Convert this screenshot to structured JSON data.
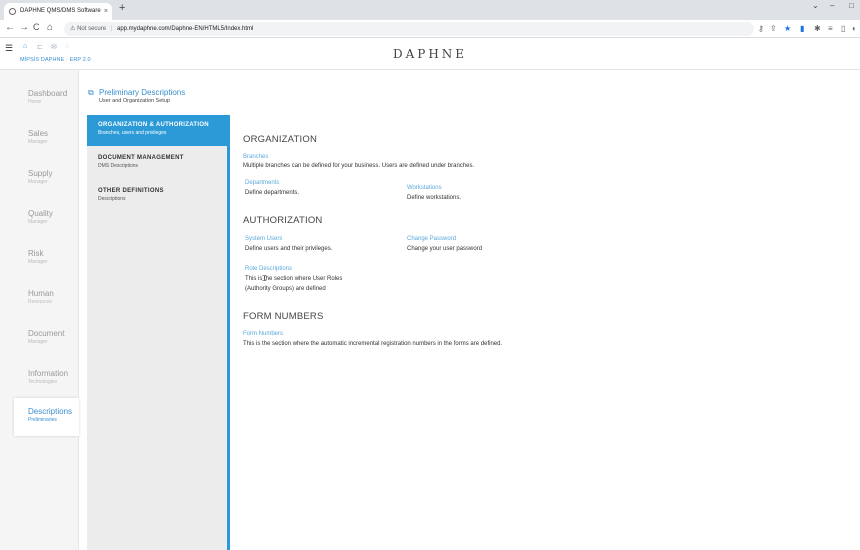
{
  "browser": {
    "tab_title": "DAPHNE QMS/DMS Software",
    "tab_close": "×",
    "new_tab": "+",
    "security": "Not secure",
    "url": "app.mydaphne.com/Daphne-EN/HTML5/Index.html",
    "back": "←",
    "forward": "→",
    "reload": "C",
    "home": "⌂"
  },
  "header": {
    "brand": "DAPHNE",
    "erp_label": "MİPSİS DAPHNE · ERP 2.0"
  },
  "sidebar": {
    "items": [
      {
        "title": "Dashboard",
        "sub": "Home"
      },
      {
        "title": "Sales",
        "sub": "Manager"
      },
      {
        "title": "Supply",
        "sub": "Manager"
      },
      {
        "title": "Quality",
        "sub": "Manager"
      },
      {
        "title": "Risk",
        "sub": "Manager"
      },
      {
        "title": "Human",
        "sub": "Resources"
      },
      {
        "title": "Document",
        "sub": "Manager"
      },
      {
        "title": "Information",
        "sub": "Technologies"
      },
      {
        "title": "Descriptions",
        "sub": "Preliminaries"
      }
    ]
  },
  "page": {
    "title": "Preliminary Descriptions",
    "subtitle": "User and Organization Setup"
  },
  "submenu": {
    "items": [
      {
        "title": "ORGANIZATION & AUTHORIZATION",
        "desc": "Branches, users and privileges"
      },
      {
        "title": "DOCUMENT MANAGEMENT",
        "desc": "DMS Descriptions"
      },
      {
        "title": "OTHER DEFINITIONS",
        "desc": "Descriptions"
      }
    ]
  },
  "main": {
    "organization": {
      "heading": "ORGANIZATION",
      "branches_link": "Branches",
      "branches_desc": "Multiple branches can be defined for your business. Users are defined under branches.",
      "departments_link": "Departments",
      "departments_desc": "Define departments.",
      "workstations_link": "Workstations",
      "workstations_desc": "Define workstations."
    },
    "authorization": {
      "heading": "AUTHORIZATION",
      "system_users_link": "System Users",
      "system_users_desc": "Define users and their privileges.",
      "change_password_link": "Change Password",
      "change_password_desc": "Change your user password",
      "role_desc_link": "Role Descriptions",
      "role_desc_line1": "This is the section where User Roles",
      "role_desc_line2": "(Authority Groups) are defined"
    },
    "form_numbers": {
      "heading": "FORM NUMBERS",
      "link": "Form Numbers",
      "desc": "This is the section where the automatic incremental registration numbers in the forms are defined."
    }
  }
}
